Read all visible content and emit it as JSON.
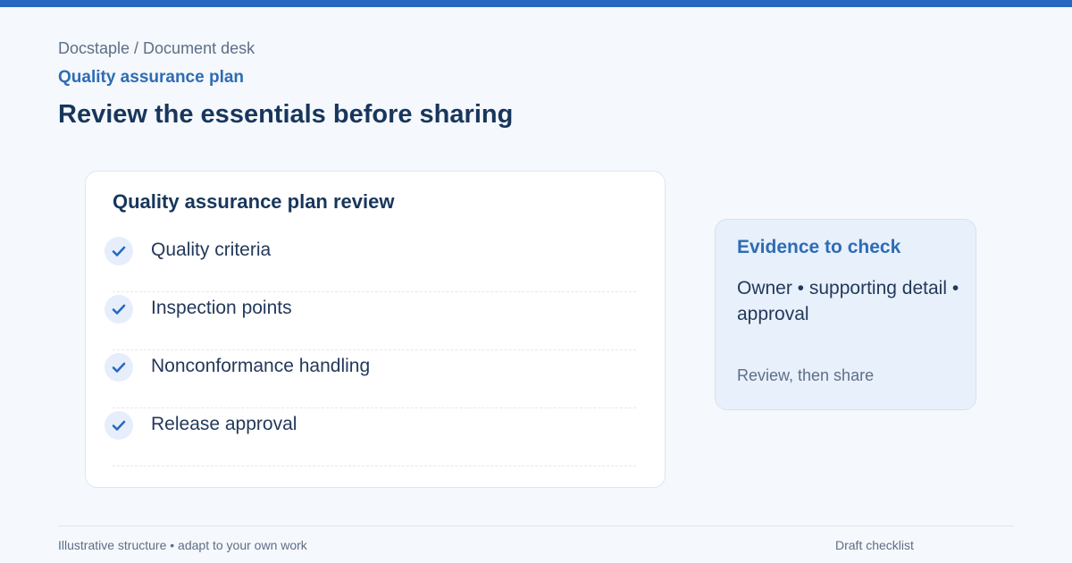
{
  "header": {
    "breadcrumb": "Docstaple / Document desk",
    "section_label": "Quality assurance plan",
    "title": "Review the essentials before sharing"
  },
  "checklist": {
    "title": "Quality assurance plan review",
    "items": [
      {
        "label": "Quality criteria",
        "checked": true,
        "icon": "check-icon"
      },
      {
        "label": "Inspection points",
        "checked": true,
        "icon": "check-icon"
      },
      {
        "label": "Nonconformance handling",
        "checked": true,
        "icon": "check-icon"
      },
      {
        "label": "Release approval",
        "checked": true,
        "icon": "check-icon"
      }
    ]
  },
  "evidence": {
    "title": "Evidence to check",
    "body": "Owner • supporting detail • approval",
    "note": "Review, then share"
  },
  "footer": {
    "left": "Illustrative structure • adapt to your own work",
    "right": "Draft checklist"
  },
  "colors": {
    "accent": "#2767c0",
    "heading": "#18365c",
    "muted": "#5d6f86",
    "panel": "#e8f0fb"
  }
}
